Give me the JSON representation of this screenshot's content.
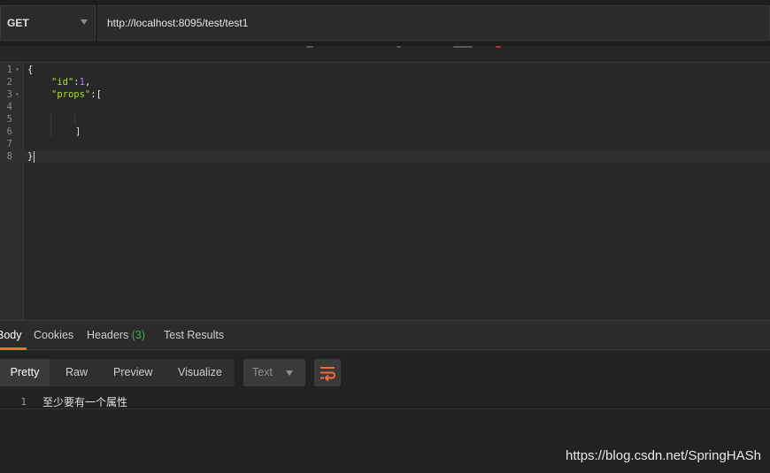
{
  "request": {
    "method": "GET",
    "url": "http://localhost:8095/test/test1"
  },
  "editor": {
    "lines": [
      {
        "num": "1",
        "text": "{"
      },
      {
        "num": "2",
        "key": "\"id\"",
        "sep": ":",
        "value": "1",
        "tail": ","
      },
      {
        "num": "3",
        "key": "\"props\"",
        "sep": ":",
        "tail": "["
      },
      {
        "num": "4",
        "text": ""
      },
      {
        "num": "5",
        "text": ""
      },
      {
        "num": "6",
        "text": "]"
      },
      {
        "num": "7",
        "text": ""
      },
      {
        "num": "8",
        "text": "}"
      }
    ]
  },
  "response_tabs": [
    {
      "label": "Body"
    },
    {
      "label": "Cookies"
    },
    {
      "label": "Headers",
      "count": "(3)"
    },
    {
      "label": "Test Results"
    }
  ],
  "toolbar": {
    "views": [
      "Pretty",
      "Raw",
      "Preview",
      "Visualize"
    ],
    "format": "Text",
    "wrap_icon": "wrap-lines-icon"
  },
  "response": {
    "line_number": "1",
    "text": "至少要有一个属性"
  },
  "watermark": "https://blog.csdn.net/SpringHASh",
  "colors": {
    "accent": "#f26b3a",
    "json_key": "#a6e22e",
    "json_number": "#ae81ff",
    "count_green": "#3fae5a"
  }
}
